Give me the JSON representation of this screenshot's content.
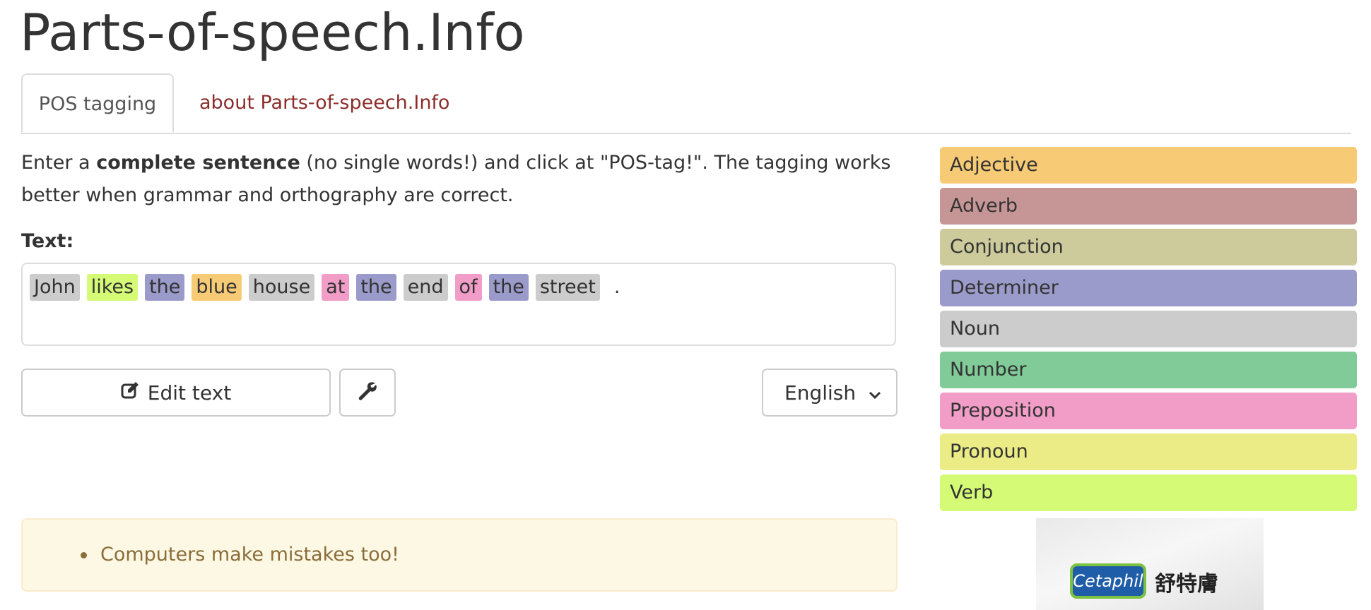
{
  "site": {
    "title": "Parts-of-speech.Info"
  },
  "tabs": [
    {
      "label": "POS tagging",
      "active": true
    },
    {
      "label": "about Parts-of-speech.Info",
      "active": false
    }
  ],
  "intro": {
    "prefix": "Enter a ",
    "bold": "complete sentence",
    "suffix": " (no single words!) and click at \"POS-tag!\". The tagging works better when grammar and orthography are correct."
  },
  "text_label": "Text:",
  "tokens": [
    {
      "word": "John",
      "pos": "Noun"
    },
    {
      "word": "likes",
      "pos": "Verb"
    },
    {
      "word": "the",
      "pos": "Determiner"
    },
    {
      "word": "blue",
      "pos": "Adjective"
    },
    {
      "word": "house",
      "pos": "Noun"
    },
    {
      "word": "at",
      "pos": "Preposition"
    },
    {
      "word": "the",
      "pos": "Determiner"
    },
    {
      "word": "end",
      "pos": "Noun"
    },
    {
      "word": "of",
      "pos": "Preposition"
    },
    {
      "word": "the",
      "pos": "Determiner"
    },
    {
      "word": "street",
      "pos": "Noun"
    },
    {
      "word": ".",
      "pos": "Punctuation"
    }
  ],
  "buttons": {
    "edit_label": "Edit text",
    "edit_icon": "edit-icon",
    "settings_icon": "wrench-icon"
  },
  "language": {
    "selected": "English"
  },
  "alert": {
    "items": [
      "Computers make mistakes too!"
    ]
  },
  "legend": [
    {
      "label": "Adjective",
      "color": "#f7cb75"
    },
    {
      "label": "Adverb",
      "color": "#c59695"
    },
    {
      "label": "Conjunction",
      "color": "#cdcb9b"
    },
    {
      "label": "Determiner",
      "color": "#9b9bcb"
    },
    {
      "label": "Noun",
      "color": "#cccccc"
    },
    {
      "label": "Number",
      "color": "#80cb98"
    },
    {
      "label": "Preposition",
      "color": "#f19dc8"
    },
    {
      "label": "Pronoun",
      "color": "#ecec86"
    },
    {
      "label": "Verb",
      "color": "#d5fa76"
    }
  ],
  "ad": {
    "brand": "Cetaphil",
    "brand_cn": "舒特膚"
  }
}
